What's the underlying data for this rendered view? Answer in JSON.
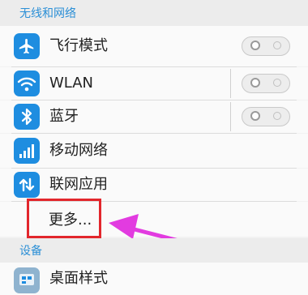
{
  "sections": {
    "wireless": "无线和网络",
    "device": "设备"
  },
  "items": {
    "airplane": {
      "label": "飞行模式",
      "toggle_on": false
    },
    "wlan": {
      "label": "WLAN",
      "toggle_on": false
    },
    "bluetooth": {
      "label": "蓝牙",
      "toggle_on": false
    },
    "mobile_network": {
      "label": "移动网络"
    },
    "network_apps": {
      "label": "联网应用"
    },
    "more": {
      "label": "更多..."
    },
    "desktop_style": {
      "label": "桌面样式"
    }
  },
  "colors": {
    "accent": "#1e8de0",
    "section_text": "#2b8fd6",
    "highlight": "#e2262c",
    "arrow": "#e23be0"
  },
  "icons": [
    "airplane-icon",
    "wifi-icon",
    "bluetooth-icon",
    "signal-icon",
    "updown-arrows-icon",
    "desktop-style-icon"
  ]
}
